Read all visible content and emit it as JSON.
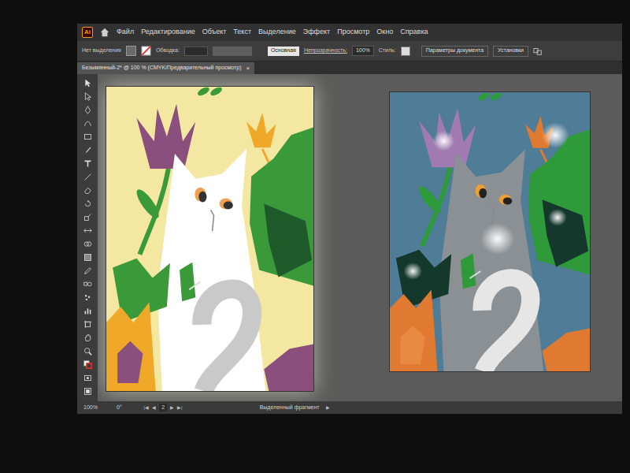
{
  "app": {
    "logo": "Ai"
  },
  "menu": [
    {
      "label": "Файл"
    },
    {
      "label": "Редактирование"
    },
    {
      "label": "Объект"
    },
    {
      "label": "Текст"
    },
    {
      "label": "Выделение"
    },
    {
      "label": "Эффект"
    },
    {
      "label": "Просмотр"
    },
    {
      "label": "Окно"
    },
    {
      "label": "Справка"
    }
  ],
  "control_bar": {
    "selection": "Нет выделения",
    "stroke_label": "Обводка:",
    "brush": "Основная",
    "opacity_label": "Непрозрачность:",
    "opacity": "100%",
    "style_label": "Стиль:",
    "doc_settings": "Параметры документа",
    "preferences": "Установки"
  },
  "document_tab": {
    "title": "Безымянный-2* @ 100 % (CMYK/Предварительный просмотр)",
    "close": "×",
    "selected": true
  },
  "artboards": [
    {
      "color": "#f3e7a2"
    },
    {
      "color": "#4f7c97"
    }
  ],
  "status_bar": {
    "zoom": "100%",
    "rotation": "0°",
    "nav": [
      "|◀",
      "◀",
      "▶",
      "▶|"
    ],
    "artboard": "2",
    "tool": "Выделенный фрагмент",
    "arrow": "▶"
  }
}
